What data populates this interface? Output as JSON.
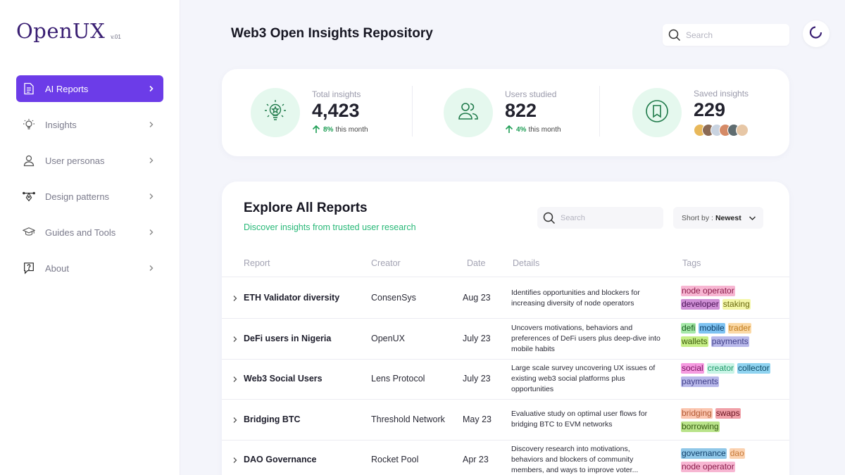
{
  "app": {
    "logo": "OpenUX",
    "version": "v.01"
  },
  "sidebar": {
    "items": [
      {
        "label": "AI Reports",
        "icon": "document-icon",
        "active": true
      },
      {
        "label": "Insights",
        "icon": "lightbulb-icon"
      },
      {
        "label": "User personas",
        "icon": "user-icon"
      },
      {
        "label": "Design patterns",
        "icon": "pen-tool-icon"
      },
      {
        "label": "Guides and Tools",
        "icon": "graduation-cap-icon"
      },
      {
        "label": "About",
        "icon": "help-bubble-icon"
      }
    ]
  },
  "header": {
    "title": "Web3 Open Insights Repository",
    "search_placeholder": "Search"
  },
  "stats": [
    {
      "label": "Total insights",
      "value": "4,423",
      "trend_value": "8%",
      "trend_text": "this month",
      "icon": "lightbulb-icon"
    },
    {
      "label": "Users studied",
      "value": "822",
      "trend_value": "4%",
      "trend_text": "this month",
      "icon": "users-icon"
    },
    {
      "label": "Saved insights",
      "value": "229",
      "icon": "bookmark-icon"
    }
  ],
  "reports": {
    "title": "Explore All Reports",
    "subtitle": "Discover insights from trusted user research",
    "search_placeholder": "Search",
    "sort_label": "Short by :",
    "sort_value": "Newest",
    "columns": {
      "report": "Report",
      "creator": "Creator",
      "date": "Date",
      "details": "Details",
      "tags": "Tags"
    },
    "rows": [
      {
        "name": "ETH Validator diversity",
        "creator": "ConsenSys",
        "date": "Aug 23",
        "details": "Identifies opportunities and blockers for increasing diversity of node operators",
        "tags": [
          "node operator",
          "developer",
          "staking"
        ]
      },
      {
        "name": "DeFi users in Nigeria",
        "creator": "OpenUX",
        "date": "July 23",
        "details": "Uncovers motivations, behaviors and preferences of DeFi users plus deep-dive into mobile habits",
        "tags": [
          "defi",
          "mobile",
          "trader",
          "wallets",
          "payments"
        ]
      },
      {
        "name": "Web3 Social Users",
        "creator": "Lens Protocol",
        "date": "July 23",
        "details": "Large scale survey uncovering UX issues of existing web3 social platforms plus opportunities",
        "tags": [
          "social",
          "creator",
          "collector",
          "payments"
        ]
      },
      {
        "name": "Bridging BTC",
        "creator": "Threshold Network",
        "date": "May 23",
        "details": "Evaluative study on optimal user flows for bridging BTC to EVM networks",
        "tags": [
          "bridging",
          "swaps",
          "borrowing"
        ]
      },
      {
        "name": "DAO Governance",
        "creator": "Rocket Pool",
        "date": "Apr 23",
        "details": "Discovery research into motivations, behaviors and blockers of community members, and ways to improve voter...",
        "tags": [
          "governance",
          "dao",
          "node operator"
        ]
      }
    ]
  },
  "colors": {
    "accent": "#6c3ce8",
    "green": "#27b877",
    "logo": "#3a1f73"
  }
}
